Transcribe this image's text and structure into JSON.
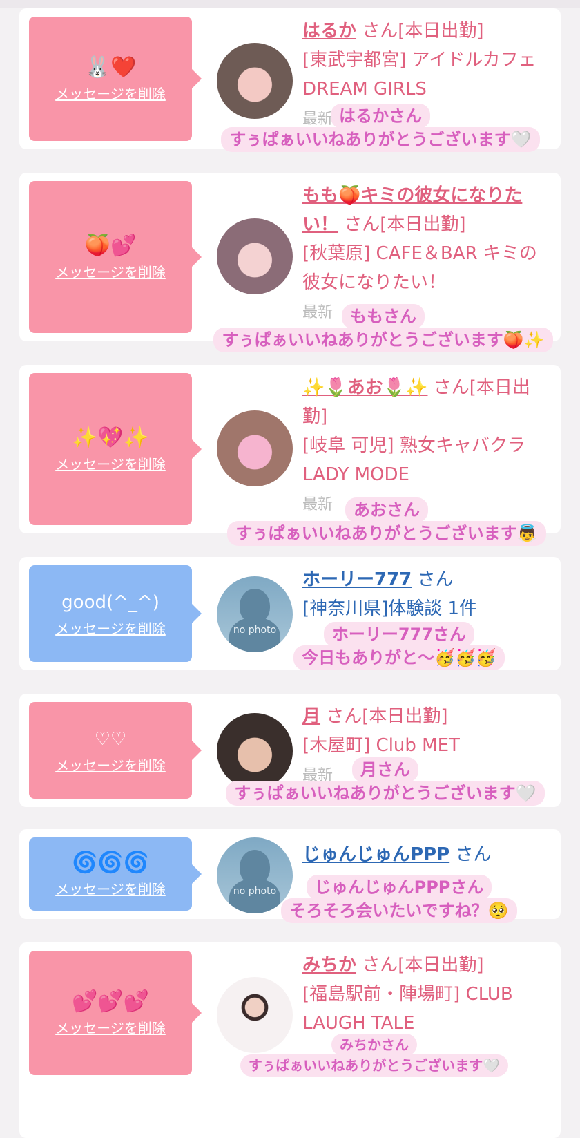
{
  "delete_label": "メッセージを削除",
  "san_label": "さん",
  "cards": [
    {
      "emoji": "🐰❤️",
      "name": "はるか",
      "after": "さん[本日出勤]",
      "shop": "[東武宇都宮] アイドルカフェDREAM GIRLS",
      "faded": "最新",
      "caption1": "はるかさん",
      "caption2": "すぅぱぁいいねありがとうございます🤍"
    },
    {
      "emoji": "🍑💕",
      "name": "もも🍑キミの彼女になりたい！",
      "after": "さん[本日出勤]",
      "shop": "[秋葉原] CAFE＆BAR キミの彼女になりたい！",
      "faded": "最新",
      "caption1": "ももさん",
      "caption2": "すぅぱぁいいねありがとうございます🍑✨"
    },
    {
      "emoji": "✨💖✨",
      "name": "✨🌷あお🌷✨",
      "after": "さん[本日出勤]",
      "shop": "[岐阜 可児] 熟女キャバクラ LADY MODE",
      "faded": "最新",
      "caption1": "あおさん",
      "caption2": "すぅぱぁいいねありがとうございます👼"
    },
    {
      "emoji": "good(^_^)",
      "name": "ホーリー777",
      "after": "さん",
      "shop": "[神奈川県]体験談 1件",
      "faded": "",
      "caption1": "ホーリー777さん",
      "caption2": "今日もありがと〜🥳🥳🥳"
    },
    {
      "emoji": "♡♡",
      "name": "月",
      "after": "さん[本日出勤]",
      "shop": "[木屋町] Club MET",
      "faded": "最新",
      "caption1": "月さん",
      "caption2": "すぅぱぁいいねありがとうございます🤍"
    },
    {
      "emoji": "🌀🌀🌀",
      "name": "じゅんじゅんPPP",
      "after": "さん",
      "shop": "",
      "faded": "",
      "caption1": "じゅんじゅんPPPさん",
      "caption2": "そろそろ会いたいですね？🥺"
    },
    {
      "emoji": "💕💕💕",
      "name": "みちか",
      "after": "さん[本日出勤]",
      "shop": "[福島駅前・陣場町] CLUB LAUGH TALE",
      "faded": "",
      "caption1": "みちかさん",
      "caption2": "すぅぱぁいいねありがとうございます🤍"
    }
  ],
  "nophoto_label": "no photo",
  "colors": {
    "pink_bubble": "#f995a8",
    "blue_bubble": "#8cb8f4",
    "pink_text": "#e0607e",
    "blue_text": "#2d68b4",
    "caption": "#d75fbe"
  }
}
